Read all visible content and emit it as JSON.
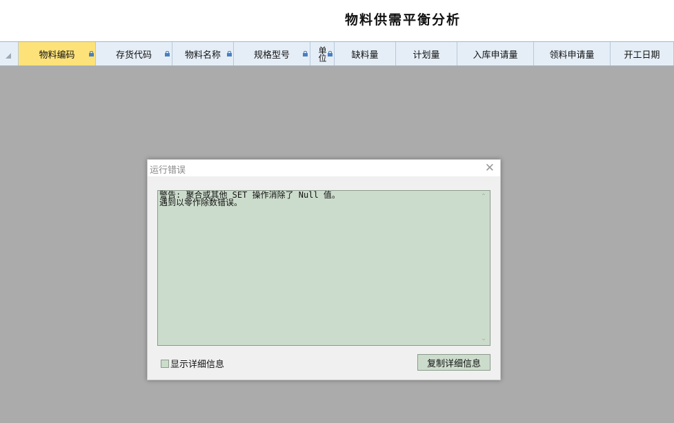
{
  "report": {
    "title": "物料供需平衡分析"
  },
  "grid": {
    "columns": [
      {
        "label": "物料编码",
        "locked": true,
        "active": true
      },
      {
        "label": "存货代码",
        "locked": true
      },
      {
        "label": "物料名称",
        "locked": true
      },
      {
        "label": "规格型号",
        "locked": true
      },
      {
        "label": "单位",
        "locked": true
      },
      {
        "label": "缺料量"
      },
      {
        "label": "计划量"
      },
      {
        "label": "入库申请量"
      },
      {
        "label": "领料申请量"
      },
      {
        "label": "开工日期"
      }
    ]
  },
  "dialog": {
    "title": "运行错误",
    "close_glyph": "✕",
    "message": "警告: 聚合或其他 SET 操作消除了 Null 值。\n遇到以零作除数错误。",
    "checkbox_label": "显示详细信息",
    "copy_button_label": "复制详细信息",
    "scroll_up_glyph": "⌃",
    "scroll_down_glyph": "⌄"
  },
  "colors": {
    "active_header": "#fde27a",
    "header_bg": "#e5eef7",
    "message_bg": "#ccdccc",
    "overlay": "#ababab"
  }
}
